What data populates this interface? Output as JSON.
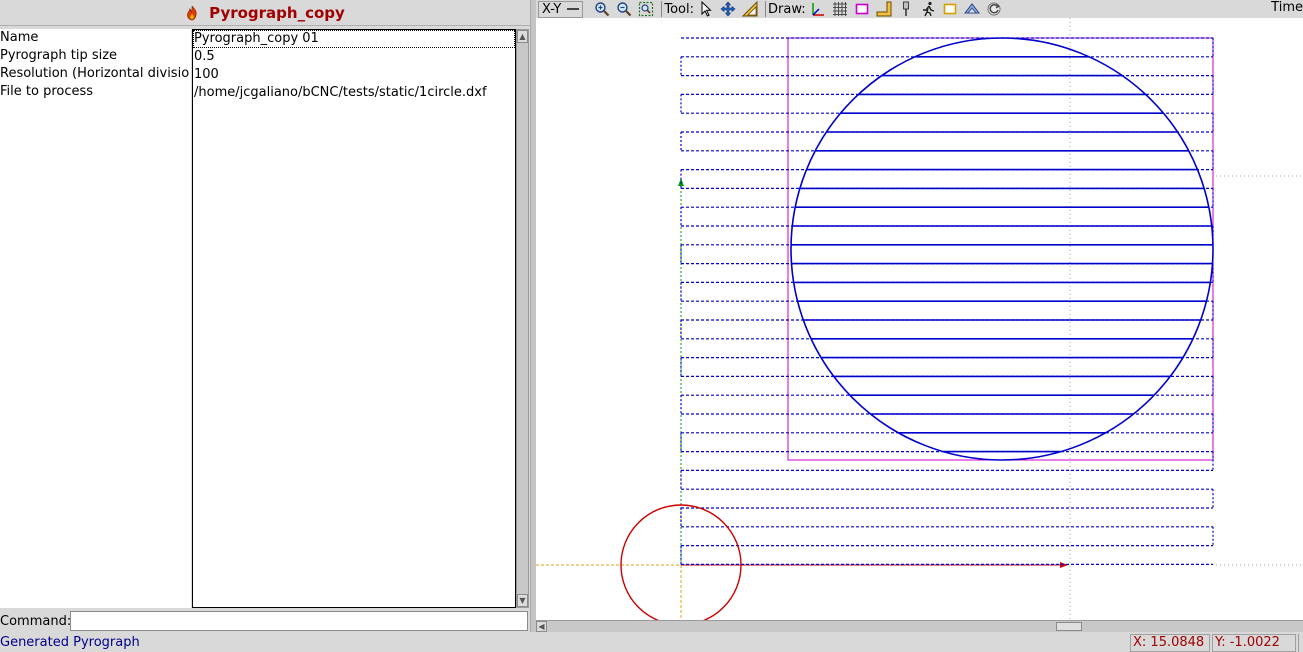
{
  "plugin": {
    "title": "Pyrograph_copy",
    "icon": "flame-icon"
  },
  "properties": [
    {
      "label": "Name",
      "value": "Pyrograph_copy 01"
    },
    {
      "label": "Pyrograph tip size",
      "value": "0.5"
    },
    {
      "label": "Resolution (Horizontal divisio",
      "value": "100"
    },
    {
      "label": "File to process",
      "value": "/home/jcgaliano/bCNC/tests/static/1circle.dxf"
    }
  ],
  "command": {
    "label": "Command:",
    "value": ""
  },
  "toolbar": {
    "view": "X-Y",
    "tool_label": "Tool:",
    "draw_label": "Draw:",
    "time_label": "Time"
  },
  "status": {
    "message": "Generated Pyrograph",
    "x": "X: 15.0848",
    "y": "Y: -1.0022"
  },
  "colors": {
    "title_red": "#a00000",
    "toolpath_blue": "#0000cc",
    "margin_magenta": "#cc00cc",
    "gantry_red": "#cc0000",
    "status_blue": "#00008b"
  }
}
